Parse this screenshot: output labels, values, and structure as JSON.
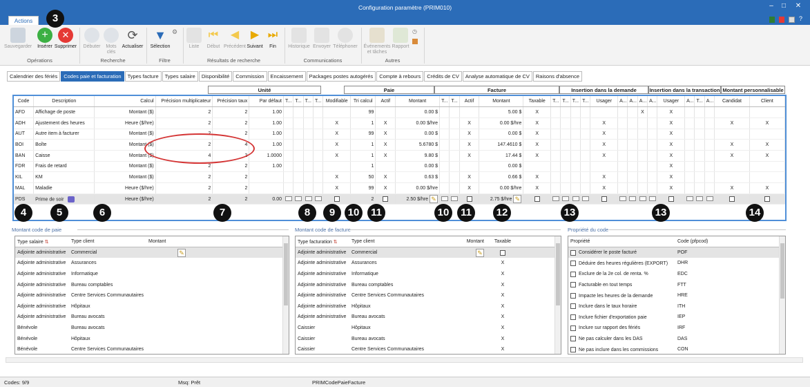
{
  "window": {
    "title": "Configuration paramètre (PRIM010)",
    "minimize": "–",
    "maximize": "□",
    "close": "✕"
  },
  "ribbon": {
    "tab": "Actions",
    "buttons": [
      "Sauvegarder",
      "Insérer",
      "Supprimer",
      "Débuter",
      "Mots clés",
      "Actualiser",
      "Sélection",
      "Liste",
      "Début",
      "Précédent",
      "Suivant",
      "Fin",
      "Historique",
      "Envoyer",
      "Téléphoner",
      "Événements et tâches",
      "Rapport"
    ],
    "groups": [
      "Opérations",
      "Recherche",
      "Filtre",
      "Résultats de recherche",
      "Communications",
      "Autres"
    ]
  },
  "nav_tabs": [
    "Calendrier des fériés",
    "Codes paie et facturation",
    "Types facture",
    "Types salaire",
    "Disponibilité",
    "Commission",
    "Encaissement",
    "Packages postes autogérés",
    "Compte à rebours",
    "Crédits de CV",
    "Analyse automatique de CV",
    "Raisons d'absence"
  ],
  "group_headers": [
    "Unité",
    "Paie",
    "Facture",
    "Insertion dans la demande",
    "Insertion dans la transaction",
    "Montant personnalisable"
  ],
  "grid": {
    "columns": [
      "Code",
      "Description",
      "Calcul",
      "Précision multiplicateur",
      "Précision taux",
      "Par défaut",
      "T...",
      "T...",
      "T...",
      "T...",
      "Modifiable",
      "Tri calcul",
      "Actif",
      "Montant",
      "T...",
      "T...",
      "Actif",
      "Montant",
      "Taxable",
      "T...",
      "T...",
      "T...",
      "T...",
      "Usager",
      "A...",
      "A...",
      "A...",
      "A...",
      "Usager",
      "A...",
      "T...",
      "A...",
      "Candidat",
      "Client"
    ],
    "rows": [
      [
        "AFD",
        "Affichage de poste",
        "Montant ($)",
        "2",
        "2",
        "1.00",
        "",
        "",
        "",
        "",
        "",
        "99",
        "",
        "0.00 $",
        "",
        "",
        "",
        "5.00 $",
        "X",
        "",
        "",
        "",
        "",
        "",
        "",
        "",
        "X",
        "",
        "X",
        "",
        "",
        "",
        "",
        ""
      ],
      [
        "ADH",
        "Ajustement des heures",
        "Heure ($/hre)",
        "2",
        "2",
        "1.00",
        "",
        "",
        "",
        "",
        "X",
        "1",
        "X",
        "0.00 $/hre",
        "",
        "",
        "X",
        "0.00 $/hre",
        "X",
        "",
        "",
        "",
        "",
        "X",
        "",
        "",
        "",
        "",
        "X",
        "",
        "",
        "",
        "X",
        "X"
      ],
      [
        "AUT",
        "Autre item à facturer",
        "Montant ($)",
        "2",
        "2",
        "1.00",
        "",
        "",
        "",
        "",
        "X",
        "99",
        "X",
        "0.00 $",
        "",
        "",
        "X",
        "0.00 $",
        "X",
        "",
        "",
        "",
        "",
        "X",
        "",
        "",
        "",
        "",
        "X",
        "",
        "",
        "",
        "",
        ""
      ],
      [
        "BOI",
        "Boîte",
        "Montant ($)",
        "2",
        "4",
        "1.00",
        "",
        "",
        "",
        "",
        "X",
        "1",
        "X",
        "5.6780 $",
        "",
        "",
        "X",
        "147.4610 $",
        "X",
        "",
        "",
        "",
        "",
        "X",
        "",
        "",
        "",
        "",
        "X",
        "",
        "",
        "",
        "X",
        "X"
      ],
      [
        "BAN",
        "Caisse",
        "Montant ($)",
        "4",
        "2",
        "1.0000",
        "",
        "",
        "",
        "",
        "X",
        "1",
        "X",
        "9.80 $",
        "",
        "",
        "X",
        "17.44 $",
        "X",
        "",
        "",
        "",
        "",
        "X",
        "",
        "",
        "",
        "",
        "X",
        "",
        "",
        "",
        "X",
        "X"
      ],
      [
        "FDR",
        "Frais de retard",
        "Montant ($)",
        "2",
        "2",
        "1.00",
        "",
        "",
        "",
        "",
        "",
        "1",
        "",
        "0.00 $",
        "",
        "",
        "",
        "0.00 $",
        "",
        "",
        "",
        "",
        "",
        "",
        "",
        "",
        "",
        "",
        "X",
        "",
        "",
        "",
        "",
        ""
      ],
      [
        "KIL",
        "KM",
        "Montant ($)",
        "2",
        "2",
        "",
        "",
        "",
        "",
        "",
        "X",
        "50",
        "X",
        "0.63 $",
        "",
        "",
        "X",
        "0.66 $",
        "X",
        "",
        "",
        "",
        "",
        "X",
        "",
        "",
        "",
        "",
        "X",
        "",
        "",
        "",
        "",
        ""
      ],
      [
        "MAL",
        "Maladie",
        "Heure ($/hre)",
        "2",
        "2",
        "",
        "",
        "",
        "",
        "",
        "X",
        "99",
        "X",
        "0.00 $/hre",
        "",
        "",
        "X",
        "0.00 $/hre",
        "X",
        "",
        "",
        "",
        "",
        "X",
        "",
        "",
        "",
        "",
        "X",
        "",
        "",
        "",
        "X",
        "X"
      ],
      [
        "PDS",
        "Prime de soir",
        "Heure ($/hre)",
        "2",
        "2",
        "0.00",
        "",
        "",
        "",
        "",
        "",
        "2",
        "",
        "2.50 $/hre",
        "",
        "",
        "",
        "2.75 $/hre",
        "",
        "",
        "",
        "",
        "",
        "",
        "",
        "",
        "",
        "",
        "",
        "",
        "",
        "",
        "",
        ""
      ]
    ]
  },
  "callouts": [
    "3",
    "4",
    "5",
    "6",
    "7",
    "8",
    "9",
    "10",
    "11",
    "10",
    "11",
    "12",
    "13",
    "13",
    "14"
  ],
  "paie": {
    "title": "Montant code de paie",
    "columns": [
      "Type salaire",
      "Type client",
      "Montant"
    ],
    "rows": [
      [
        "Adjointe administrative",
        "Commercial"
      ],
      [
        "Adjointe administrative",
        "Assurances"
      ],
      [
        "Adjointe administrative",
        "Informatique"
      ],
      [
        "Adjointe administrative",
        "Bureau comptables"
      ],
      [
        "Adjointe administrative",
        "Centre Services Communautaires"
      ],
      [
        "Adjointe administrative",
        "Hôpitaux"
      ],
      [
        "Adjointe administrative",
        "Bureau avocats"
      ],
      [
        "Bénévole",
        "Bureau avocats"
      ],
      [
        "Bénévole",
        "Hôpitaux"
      ],
      [
        "Bénévole",
        "Centre Services Communautaires"
      ]
    ]
  },
  "facture": {
    "title": "Montant code de facture",
    "columns": [
      "Type facturation",
      "Type client",
      "Montant",
      "Taxable"
    ],
    "rows": [
      [
        "Adjointe administrative",
        "Commercial",
        ""
      ],
      [
        "Adjointe administrative",
        "Assurances",
        "X"
      ],
      [
        "Adjointe administrative",
        "Informatique",
        "X"
      ],
      [
        "Adjointe administrative",
        "Bureau comptables",
        "X"
      ],
      [
        "Adjointe administrative",
        "Centre Services Communautaires",
        "X"
      ],
      [
        "Adjointe administrative",
        "Hôpitaux",
        "X"
      ],
      [
        "Adjointe administrative",
        "Bureau avocats",
        "X"
      ],
      [
        "Caissier",
        "Hôpitaux",
        "X"
      ],
      [
        "Caissier",
        "Bureau avocats",
        "X"
      ],
      [
        "Caissier",
        "Centre Services Communautaires",
        "X"
      ]
    ]
  },
  "propriete": {
    "title": "Propriété du code",
    "columns": [
      "Propriété",
      "Code (pfpcod)"
    ],
    "rows": [
      [
        "Considérer le poste facturé",
        "POF"
      ],
      [
        "Déduire des heures régulières (EXPORT)",
        "DHR"
      ],
      [
        "Exclure de la 2e col. de renta. %",
        "EDC"
      ],
      [
        "Facturable en tout temps",
        "FTT"
      ],
      [
        "Impacte les heures de la demande",
        "HRE"
      ],
      [
        "Inclure dans le taux horaire",
        "ITH"
      ],
      [
        "Inclure fichier d'exportation paie",
        "IEP"
      ],
      [
        "Inclure sur rapport des fériés",
        "IRF"
      ],
      [
        "Ne pas calculer dans les DAS",
        "DAS"
      ],
      [
        "Ne pas inclure dans les commissions",
        "CON"
      ]
    ]
  },
  "status": {
    "count": "Codes: 9/9",
    "msg": "Msq: Prêt",
    "table": "PRIMCodePaieFacture"
  },
  "colors": {
    "accent": "#2b6cb8",
    "callout": "#111111",
    "highlight": "#d43434"
  }
}
